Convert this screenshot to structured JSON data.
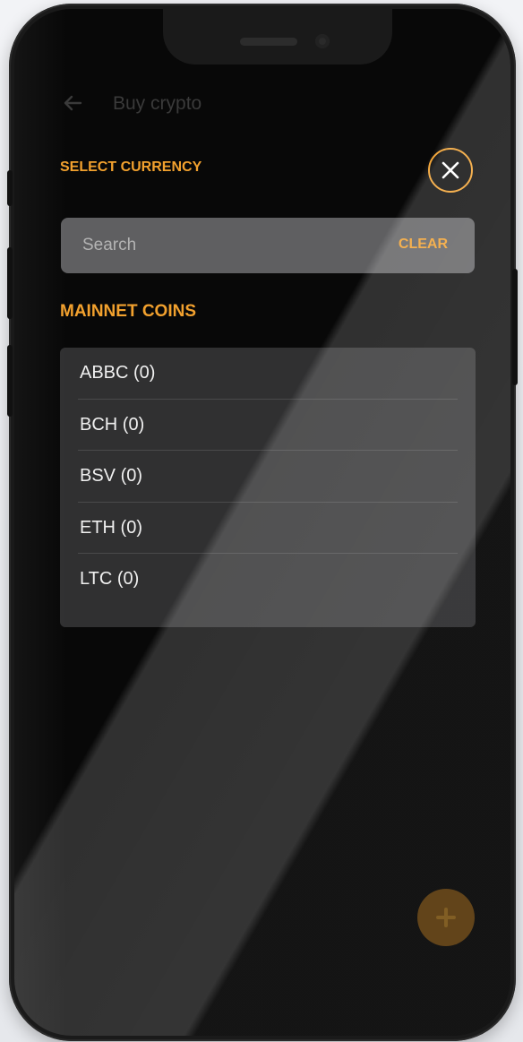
{
  "app_bar": {
    "title": "Buy crypto",
    "back_icon": "arrow-left-icon"
  },
  "modal": {
    "title": "SELECT CURRENCY",
    "close_icon": "close-icon",
    "search": {
      "placeholder": "Search",
      "value": "",
      "clear_label": "CLEAR"
    },
    "section_title": "MAINNET COINS",
    "coins": [
      {
        "label": "ABBC (0)"
      },
      {
        "label": "BCH (0)"
      },
      {
        "label": "BSV (0)"
      },
      {
        "label": "ETH (0)"
      },
      {
        "label": "LTC (0)"
      }
    ]
  },
  "fab": {
    "icon": "plus-icon"
  },
  "colors": {
    "accent": "#f2a12e",
    "screen_background": "#080808",
    "search_background": "#5f5f61",
    "list_background": "#303031"
  }
}
